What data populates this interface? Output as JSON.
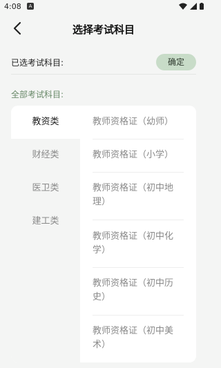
{
  "status": {
    "time": "4:08",
    "notif_letter": "A"
  },
  "header": {
    "title": "选择考试科目"
  },
  "selected": {
    "label": "已选考试科目:",
    "confirm": "确定"
  },
  "all_subjects_label": "全部考试科目:",
  "categories": [
    {
      "label": "教资类",
      "active": true
    },
    {
      "label": "财经类",
      "active": false
    },
    {
      "label": "医卫类",
      "active": false
    },
    {
      "label": "建工类",
      "active": false
    }
  ],
  "subjects": [
    {
      "label": "教师资格证（幼师）"
    },
    {
      "label": "教师资格证（小学）"
    },
    {
      "label": "教师资格证（初中地理）"
    },
    {
      "label": "教师资格证（初中化学）"
    },
    {
      "label": "教师资格证（初中历史）"
    },
    {
      "label": "教师资格证（初中美术）"
    }
  ],
  "colors": {
    "accent": "#c8dcc8",
    "section_label": "#6a8a6a"
  }
}
